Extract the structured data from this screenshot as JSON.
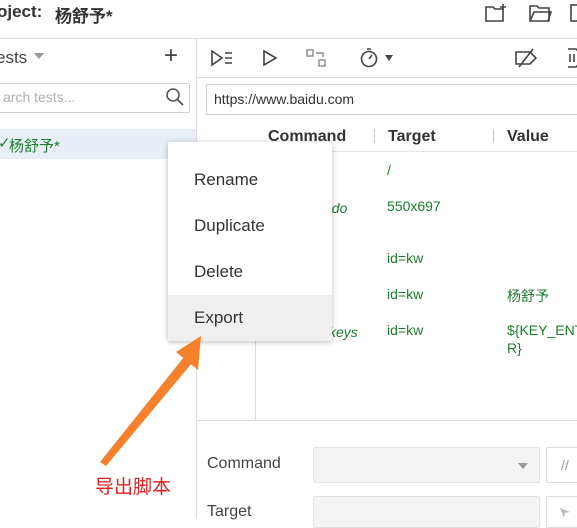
{
  "header": {
    "project_label": "oject:",
    "project_name": "杨舒予*",
    "icons": [
      "new-project-icon",
      "open-project-icon",
      "save-project-icon"
    ]
  },
  "sidebar": {
    "title": "ests",
    "add_label": "+",
    "search_placeholder": "arch tests...",
    "tests": [
      {
        "check": "✓",
        "name": "杨舒予*"
      }
    ]
  },
  "toolbar": {
    "icons": [
      "run-all-tests-icon",
      "run-current-test-icon",
      "step-over-icon",
      "speed-timer-icon",
      "disable-breakpoints-icon",
      "pause-on-exceptions-icon"
    ]
  },
  "url": {
    "value": "https://www.baidu.com"
  },
  "table": {
    "headers": {
      "command": "Command",
      "target": "Target",
      "value": "Value"
    },
    "rows": [
      {
        "command": "",
        "target": "/",
        "value": ""
      },
      {
        "command": "ndo",
        "target": "550x697",
        "value": ""
      },
      {
        "command": "",
        "target": "id=kw",
        "value": ""
      },
      {
        "command": "",
        "target": "id=kw",
        "value": "杨舒予"
      },
      {
        "command": "keys",
        "target": "id=kw",
        "value_line1": "${KEY_ENT",
        "value_line2": "R}"
      }
    ]
  },
  "editor": {
    "command_label": "Command",
    "target_label": "Target",
    "comment_toggle": "//"
  },
  "context_menu": {
    "items": [
      "Rename",
      "Duplicate",
      "Delete",
      "Export"
    ],
    "hovered": "Export"
  },
  "annotation": {
    "text": "导出脚本",
    "color": "#e02020",
    "arrow_color": "#f5822a"
  },
  "colors": {
    "pass_green": "#1c7d2c",
    "selected_row": "#e8eef6",
    "menu_hover": "#efefef"
  }
}
